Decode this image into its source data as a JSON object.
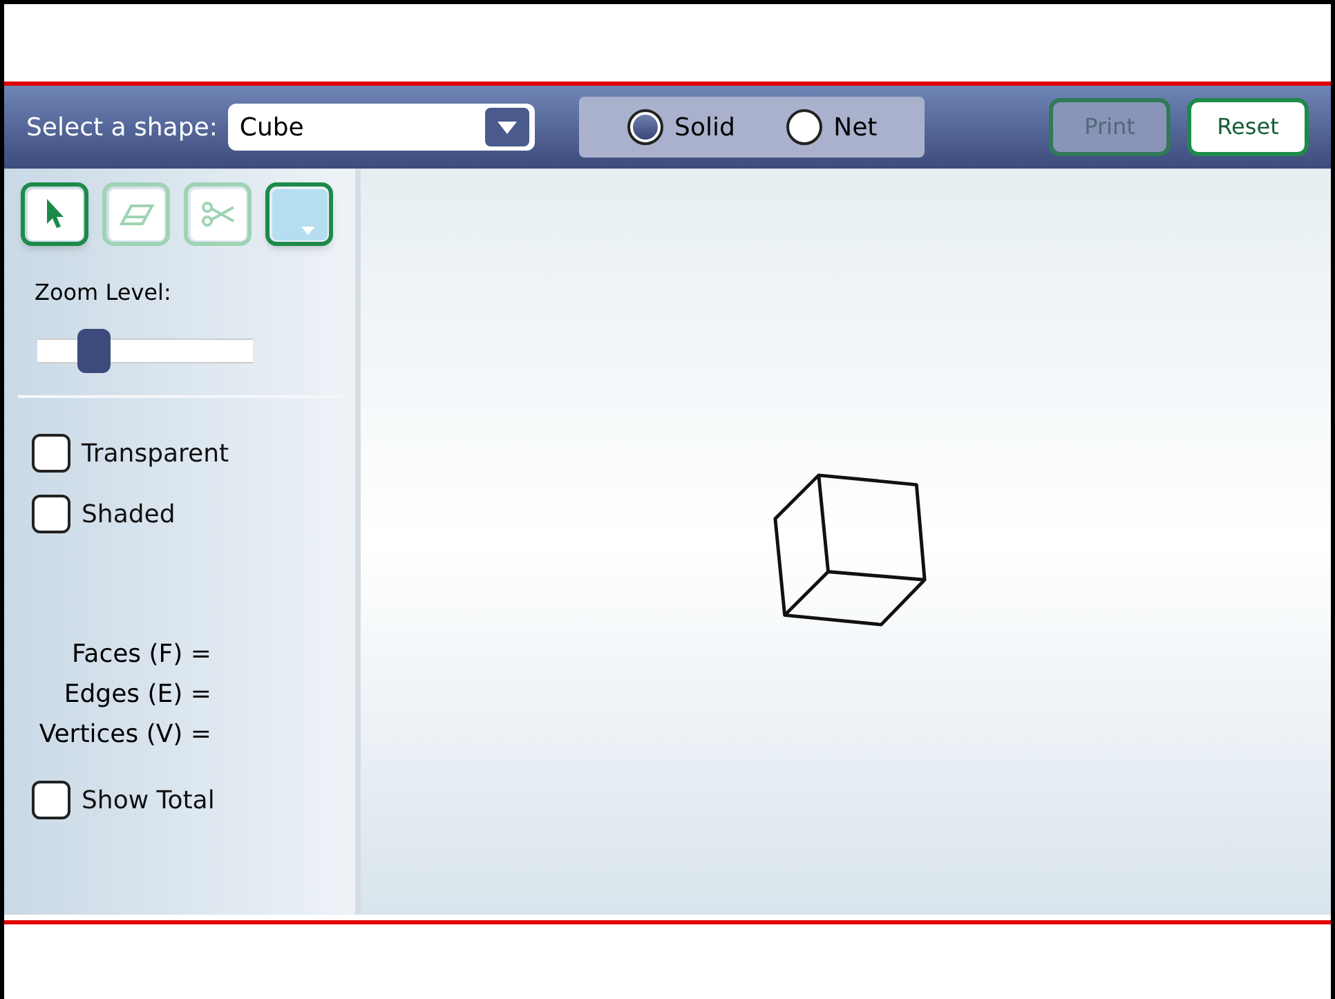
{
  "toolbar": {
    "shape_label": "Select a shape:",
    "shape_value": "Cube",
    "view_options": [
      {
        "label": "Solid",
        "selected": true
      },
      {
        "label": "Net",
        "selected": false
      }
    ],
    "buttons": [
      {
        "label": "Print",
        "disabled": true
      },
      {
        "label": "Reset",
        "disabled": false
      }
    ]
  },
  "sidebar": {
    "tools": [
      {
        "kind": "pointer",
        "selected": true,
        "disabled": false
      },
      {
        "kind": "eraser",
        "selected": false,
        "disabled": true
      },
      {
        "kind": "scissors",
        "selected": false,
        "disabled": true
      },
      {
        "kind": "color",
        "selected": true,
        "disabled": false
      }
    ],
    "zoom": {
      "label": "Zoom Level:",
      "level": 0.26
    },
    "options": [
      {
        "label": "Transparent",
        "checked": false
      },
      {
        "label": "Shaded",
        "checked": false
      }
    ],
    "counts": [
      "Faces (F) =",
      "Edges (E) =",
      "Vertices (V) ="
    ],
    "show_total": {
      "label": "Show Total",
      "checked": false
    }
  }
}
